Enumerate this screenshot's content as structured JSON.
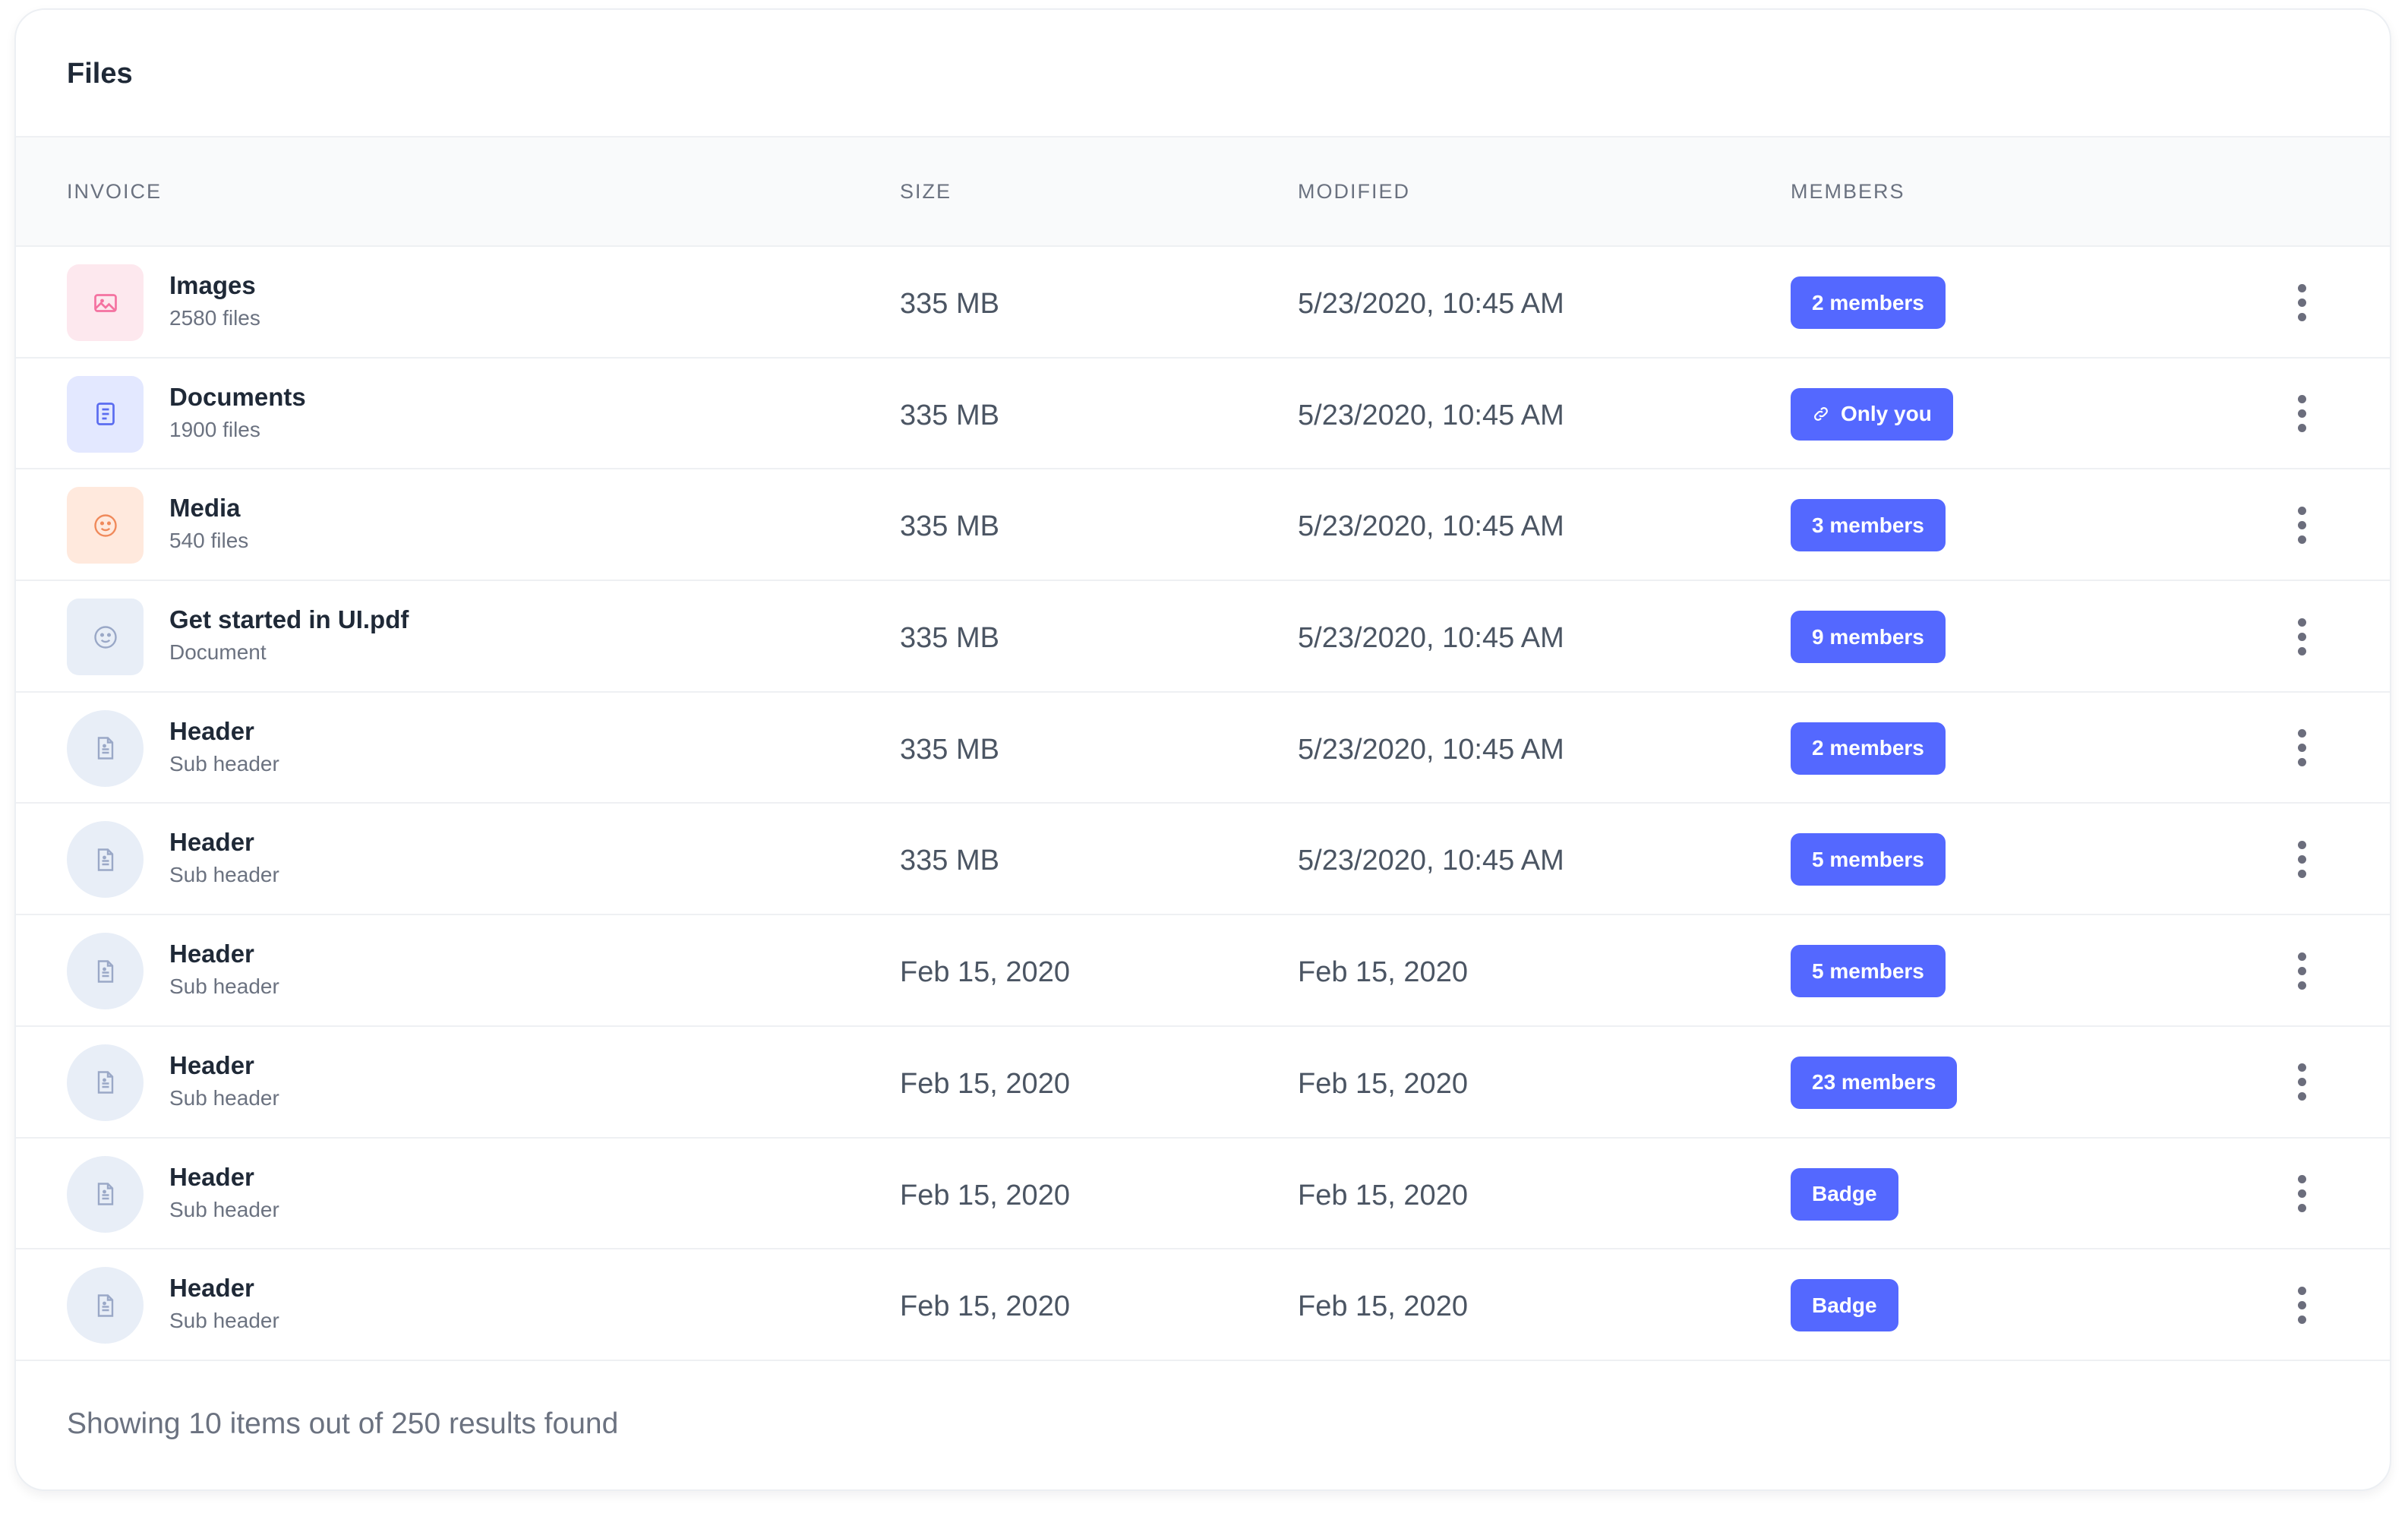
{
  "card": {
    "title": "Files"
  },
  "table": {
    "headers": {
      "invoice": "INVOICE",
      "size": "SIZE",
      "modified": "MODIFIED",
      "members": "MEMBERS"
    },
    "rows": [
      {
        "name": "Images",
        "sub": "2580 files",
        "size": "335 MB",
        "modified": "5/23/2020, 10:45 AM",
        "badge": "2 members",
        "icon": "image-icon",
        "icon_shape": "square",
        "icon_bg": "#fde8ee",
        "icon_color": "#f472a0",
        "badge_icon": ""
      },
      {
        "name": "Documents",
        "sub": "1900 files",
        "size": "335 MB",
        "modified": "5/23/2020, 10:45 AM",
        "badge": "Only you",
        "icon": "document-icon",
        "icon_shape": "square",
        "icon_bg": "#e3e8ff",
        "icon_color": "#5b6cf0",
        "badge_icon": "link-icon"
      },
      {
        "name": "Media",
        "sub": "540 files",
        "size": "335 MB",
        "modified": "5/23/2020, 10:45 AM",
        "badge": "3 members",
        "icon": "smile-icon",
        "icon_shape": "square",
        "icon_bg": "#ffe9dd",
        "icon_color": "#f08a5b",
        "badge_icon": ""
      },
      {
        "name": "Get started in UI.pdf",
        "sub": "Document",
        "size": "335 MB",
        "modified": "5/23/2020, 10:45 AM",
        "badge": "9 members",
        "icon": "smile-icon",
        "icon_shape": "square",
        "icon_bg": "#e8eef7",
        "icon_color": "#9aa8c7",
        "badge_icon": ""
      },
      {
        "name": "Header",
        "sub": "Sub header",
        "size": "335 MB",
        "modified": "5/23/2020, 10:45 AM",
        "badge": "2 members",
        "icon": "file-icon",
        "icon_shape": "circle",
        "icon_bg": "#e8eef7",
        "icon_color": "#9aa8c7",
        "badge_icon": ""
      },
      {
        "name": "Header",
        "sub": "Sub header",
        "size": "335 MB",
        "modified": "5/23/2020, 10:45 AM",
        "badge": "5 members",
        "icon": "file-icon",
        "icon_shape": "circle",
        "icon_bg": "#e8eef7",
        "icon_color": "#9aa8c7",
        "badge_icon": ""
      },
      {
        "name": "Header",
        "sub": "Sub header",
        "size": "Feb 15, 2020",
        "modified": "Feb 15, 2020",
        "badge": "5 members",
        "icon": "file-icon",
        "icon_shape": "circle",
        "icon_bg": "#e8eef7",
        "icon_color": "#9aa8c7",
        "badge_icon": ""
      },
      {
        "name": "Header",
        "sub": "Sub header",
        "size": "Feb 15, 2020",
        "modified": "Feb 15, 2020",
        "badge": "23 members",
        "icon": "file-icon",
        "icon_shape": "circle",
        "icon_bg": "#e8eef7",
        "icon_color": "#9aa8c7",
        "badge_icon": ""
      },
      {
        "name": "Header",
        "sub": "Sub header",
        "size": "Feb 15, 2020",
        "modified": "Feb 15, 2020",
        "badge": "Badge",
        "icon": "file-icon",
        "icon_shape": "circle",
        "icon_bg": "#e8eef7",
        "icon_color": "#9aa8c7",
        "badge_icon": ""
      },
      {
        "name": "Header",
        "sub": "Sub header",
        "size": "Feb 15, 2020",
        "modified": "Feb 15, 2020",
        "badge": "Badge",
        "icon": "file-icon",
        "icon_shape": "circle",
        "icon_bg": "#e8eef7",
        "icon_color": "#9aa8c7",
        "badge_icon": ""
      }
    ]
  },
  "footer": {
    "text": "Showing 10 items out of 250 results found"
  },
  "colors": {
    "badge": "#5468ff",
    "row_action": "#6b6d7c"
  }
}
